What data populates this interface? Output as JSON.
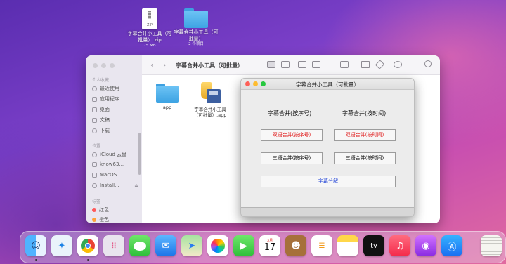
{
  "desktop": {
    "zip": {
      "name": "字幕合并小工具（可批量）.zip",
      "size": "75 MB",
      "icon_text": "ZIP"
    },
    "folder": {
      "name": "字幕合并小工具（可批量）",
      "count": "2 个项目"
    }
  },
  "finder": {
    "title": "字幕合并小工具（可批量）",
    "sidebar": {
      "favorites_heading": "个人收藏",
      "favorites": [
        "最近使用",
        "应用程序",
        "桌面",
        "文稿",
        "下载"
      ],
      "locations_heading": "位置",
      "locations": [
        "iCloud 云盘",
        "know63...",
        "MacOS",
        "Install..."
      ],
      "tags_heading": "标签",
      "tags": [
        {
          "label": "红色",
          "color": "#ff5a5a"
        },
        {
          "label": "橙色",
          "color": "#ffa23a"
        }
      ]
    },
    "files": [
      {
        "name": "app",
        "icon": "folder-icon"
      },
      {
        "name": "字幕合并小工具（可批量）.app",
        "icon": "app-icon"
      }
    ]
  },
  "dialog": {
    "title": "字幕合并小工具（可批量）",
    "head_left": "字幕合并(按序号)",
    "head_right": "字幕合并(按时间)",
    "btn_bilingual_index": "双语合并(按序号)",
    "btn_bilingual_time": "双语合并(按时间)",
    "btn_trilingual_index": "三语合并(按序号)",
    "btn_trilingual_time": "三语合并(按时间)",
    "btn_split": "字幕分解"
  },
  "dock": {
    "calendar_month": "3月",
    "calendar_day": "17",
    "apple_tv_label": "tv"
  }
}
